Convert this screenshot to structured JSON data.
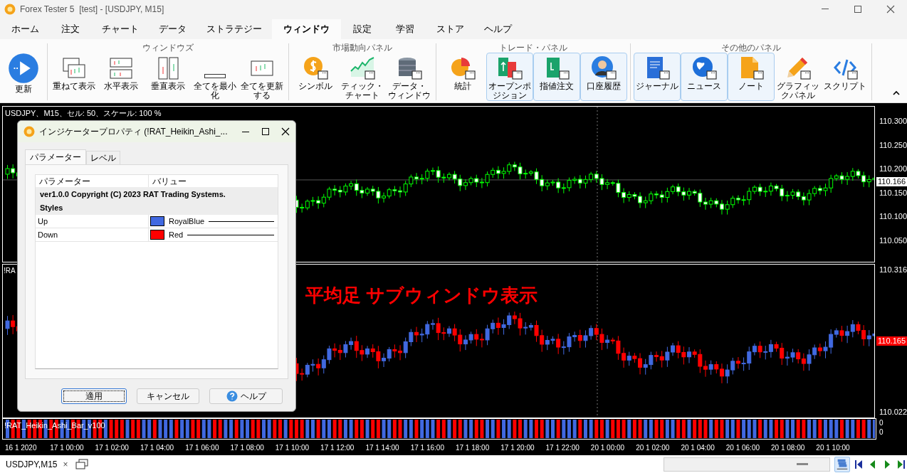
{
  "window": {
    "title": "Forex Tester 5  [test] - [USDJPY, M15]"
  },
  "menu_tabs": [
    {
      "label": "ホーム",
      "selected": false
    },
    {
      "label": "注文",
      "selected": false
    },
    {
      "label": "チャート",
      "selected": false
    },
    {
      "label": "データ",
      "selected": false
    },
    {
      "label": "ストラテジー",
      "selected": false
    },
    {
      "label": "ウィンドウ",
      "selected": true
    },
    {
      "label": "設定",
      "selected": false
    },
    {
      "label": "学習",
      "selected": false
    },
    {
      "label": "ストア",
      "selected": false
    },
    {
      "label": "ヘルプ",
      "selected": false
    }
  ],
  "ribbon": {
    "groups": [
      {
        "buttons": [
          {
            "label": "更新",
            "kind": "refresh",
            "on": false
          }
        ]
      },
      {
        "title": "ウィンドウズ",
        "buttons": [
          {
            "label": "重ねて表示",
            "kind": "cascade",
            "on": false
          },
          {
            "label": "水平表示",
            "kind": "tile-h",
            "on": false
          },
          {
            "label": "垂直表示",
            "kind": "tile-v",
            "on": false
          },
          {
            "label": "全てを最小化",
            "kind": "minimize",
            "on": false
          },
          {
            "label": "全てを更新する",
            "kind": "refresh-all",
            "on": false
          }
        ]
      },
      {
        "title": "市場動向パネル",
        "buttons": [
          {
            "label": "シンボル",
            "kind": "symbol",
            "on": false
          },
          {
            "label": "ティック・チャート",
            "kind": "tick-chart",
            "on": false
          },
          {
            "label": "データ・ウィンドウ",
            "kind": "data-window",
            "on": false
          }
        ]
      },
      {
        "title": "トレード・パネル",
        "buttons": [
          {
            "label": "統計",
            "kind": "statistics",
            "on": false
          },
          {
            "label": "オープンポジション",
            "kind": "open-positions",
            "on": true
          },
          {
            "label": "指値注文",
            "kind": "pending-orders",
            "on": true
          },
          {
            "label": "口座履歴",
            "kind": "account-history",
            "on": true
          }
        ]
      },
      {
        "title": "その他のパネル",
        "buttons": [
          {
            "label": "ジャーナル",
            "kind": "journal",
            "on": true
          },
          {
            "label": "ニュース",
            "kind": "news",
            "on": true
          },
          {
            "label": "ノート",
            "kind": "notes",
            "on": true
          },
          {
            "label": "グラフィックパネル",
            "kind": "graphic-panel",
            "on": false
          },
          {
            "label": "スクリプト",
            "kind": "script",
            "on": false
          }
        ]
      }
    ]
  },
  "chart": {
    "info": "USDJPY、M15、セル: 50、スケール: 100 %",
    "price_axis": [
      "110.300",
      "110.250",
      "110.200",
      "110.150",
      "110.100",
      "110.050"
    ],
    "current_price": "110.166",
    "subwindow": {
      "label": "!RA",
      "overlay_text": "平均足 サブウィンドウ表示",
      "price_axis": [
        "110.316",
        "110.022"
      ],
      "current_price": "110.165"
    },
    "bar_strip": {
      "label": "!RAT_Heikin_Ashi_Bar_v100",
      "axis": [
        "0",
        "0"
      ]
    },
    "time_axis": [
      "16 1 2020",
      "17 1 00:00",
      "17 1 02:00",
      "17 1 04:00",
      "17 1 06:00",
      "17 1 08:00",
      "17 1 10:00",
      "17 1 12:00",
      "17 1 14:00",
      "17 1 16:00",
      "17 1 18:00",
      "17 1 20:00",
      "17 1 22:00",
      "20 1 00:00",
      "20 1 02:00",
      "20 1 04:00",
      "20 1 06:00",
      "20 1 08:00",
      "20 1 10:00"
    ]
  },
  "dialog": {
    "title": "インジケータープロパティ (!RAT_Heikin_Ashi_...",
    "tabs": [
      {
        "label": "パラメーター",
        "selected": true
      },
      {
        "label": "レベル",
        "selected": false
      }
    ],
    "columns": [
      "パラメーター",
      "バリュー"
    ],
    "rows": [
      {
        "kind": "group",
        "text": "ver1.0.0 Copyright (C) 2023 RAT Trading Systems."
      },
      {
        "kind": "group",
        "text": "Styles"
      },
      {
        "kind": "color",
        "name": "Up",
        "value": "RoyalBlue",
        "color": "#4169e1"
      },
      {
        "kind": "color",
        "name": "Down",
        "value": "Red",
        "color": "#ff0000"
      }
    ],
    "buttons": [
      {
        "label": "適用",
        "kind": "default"
      },
      {
        "label": "キャンセル",
        "kind": "plain"
      },
      {
        "label": "ヘルプ",
        "kind": "help"
      }
    ]
  },
  "status_bar": {
    "tab": "USDJPY,M15",
    "close": "×"
  }
}
